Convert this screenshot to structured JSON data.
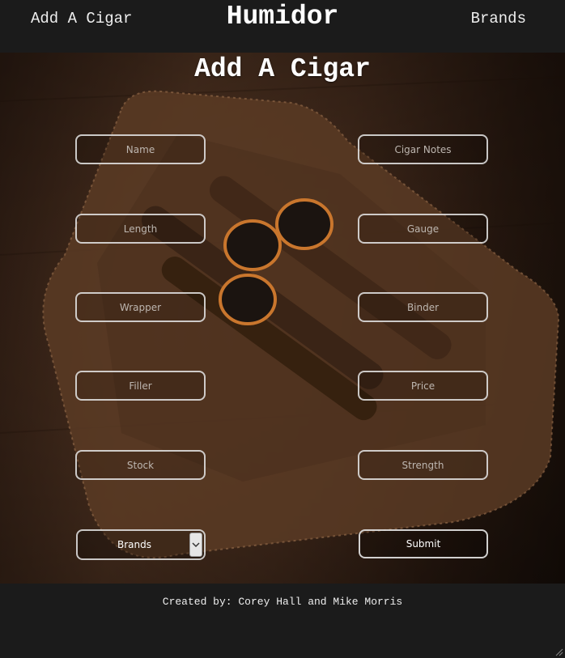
{
  "nav": {
    "left_link": "Add A Cigar",
    "title": "Humidor",
    "right_link": "Brands"
  },
  "form": {
    "heading": "Add A Cigar",
    "fields": {
      "name": "Name",
      "cigar_notes": "Cigar Notes",
      "length": "Length",
      "gauge": "Gauge",
      "wrapper": "Wrapper",
      "binder": "Binder",
      "filler": "Filler",
      "price": "Price",
      "stock": "Stock",
      "strength": "Strength"
    },
    "brands_select": "Brands",
    "submit_label": "Submit"
  },
  "footer": {
    "credit": "Created by: Corey Hall and Mike Morris"
  },
  "colors": {
    "header_bg": "#1b1b1b",
    "footer_bg": "#1b1b1b",
    "input_border": "#e6e6e6"
  },
  "icons": {
    "select_arrow": "chevron-down-icon",
    "resize": "resize-grip-icon"
  }
}
